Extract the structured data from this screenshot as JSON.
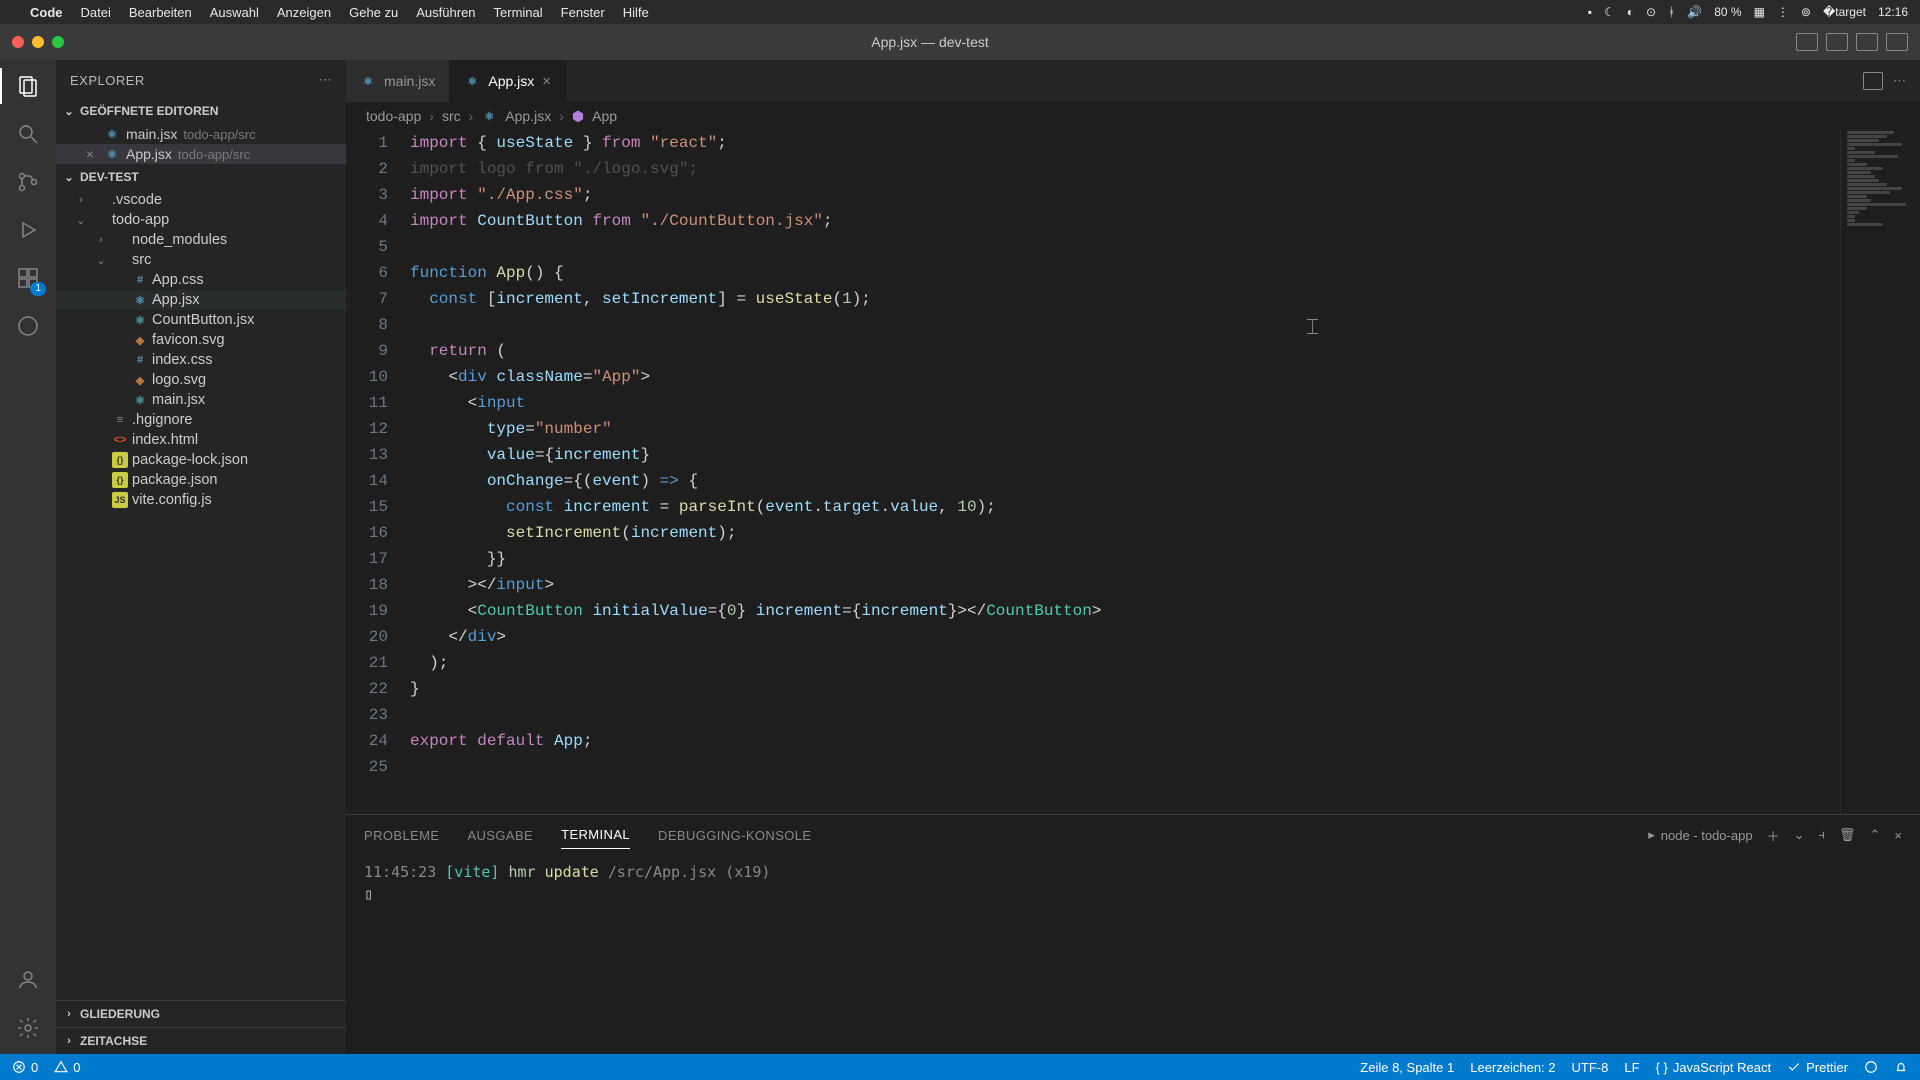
{
  "menubar": {
    "apple": "",
    "app": "Code",
    "items": [
      "Datei",
      "Bearbeiten",
      "Auswahl",
      "Anzeigen",
      "Gehe zu",
      "Ausführen",
      "Terminal",
      "Fenster",
      "Hilfe"
    ],
    "battery": "80 %",
    "clock": "12:16"
  },
  "titlebar": {
    "title": "App.jsx — dev-test"
  },
  "explorer": {
    "title": "EXPLORER",
    "openEditorsHeader": "GEÖFFNETE EDITOREN",
    "openEditors": [
      {
        "name": "main.jsx",
        "path": "todo-app/src",
        "active": false
      },
      {
        "name": "App.jsx",
        "path": "todo-app/src",
        "active": true
      }
    ],
    "workspace": "DEV-TEST",
    "tree": [
      {
        "label": ".vscode",
        "indent": 1,
        "chev": "›",
        "icon": "folder"
      },
      {
        "label": "todo-app",
        "indent": 1,
        "chev": "⌄",
        "icon": "folder"
      },
      {
        "label": "node_modules",
        "indent": 2,
        "chev": "›",
        "icon": "folder"
      },
      {
        "label": "src",
        "indent": 2,
        "chev": "⌄",
        "icon": "folder"
      },
      {
        "label": "App.css",
        "indent": 3,
        "icon": "css"
      },
      {
        "label": "App.jsx",
        "indent": 3,
        "icon": "react",
        "selected": true
      },
      {
        "label": "CountButton.jsx",
        "indent": 3,
        "icon": "react"
      },
      {
        "label": "favicon.svg",
        "indent": 3,
        "icon": "svg"
      },
      {
        "label": "index.css",
        "indent": 3,
        "icon": "css"
      },
      {
        "label": "logo.svg",
        "indent": 3,
        "icon": "svg"
      },
      {
        "label": "main.jsx",
        "indent": 3,
        "icon": "react"
      },
      {
        "label": ".hgignore",
        "indent": 2,
        "icon": "generic"
      },
      {
        "label": "index.html",
        "indent": 2,
        "icon": "html"
      },
      {
        "label": "package-lock.json",
        "indent": 2,
        "icon": "json"
      },
      {
        "label": "package.json",
        "indent": 2,
        "icon": "json"
      },
      {
        "label": "vite.config.js",
        "indent": 2,
        "icon": "js"
      }
    ],
    "outline": "GLIEDERUNG",
    "timeline": "ZEITACHSE"
  },
  "tabs": [
    {
      "name": "main.jsx",
      "active": false
    },
    {
      "name": "App.jsx",
      "active": true
    }
  ],
  "breadcrumb": [
    "todo-app",
    "src",
    "App.jsx",
    "App"
  ],
  "code": {
    "lineCount": 25,
    "lines": [
      [
        [
          "kw",
          "import"
        ],
        [
          "op",
          " { "
        ],
        [
          "var",
          "useState"
        ],
        [
          "op",
          " } "
        ],
        [
          "kw",
          "from"
        ],
        [
          "op",
          " "
        ],
        [
          "str",
          "\"react\""
        ],
        [
          "op",
          ";"
        ]
      ],
      [
        [
          "dim",
          "import logo from \"./logo.svg\";"
        ]
      ],
      [
        [
          "kw",
          "import"
        ],
        [
          "op",
          " "
        ],
        [
          "str",
          "\"./App.css\""
        ],
        [
          "op",
          ";"
        ]
      ],
      [
        [
          "kw",
          "import"
        ],
        [
          "op",
          " "
        ],
        [
          "var",
          "CountButton"
        ],
        [
          "op",
          " "
        ],
        [
          "kw",
          "from"
        ],
        [
          "op",
          " "
        ],
        [
          "str",
          "\"./CountButton.jsx\""
        ],
        [
          "op",
          ";"
        ]
      ],
      [
        [
          "op",
          ""
        ]
      ],
      [
        [
          "kw2",
          "function"
        ],
        [
          "op",
          " "
        ],
        [
          "fn",
          "App"
        ],
        [
          "op",
          "() "
        ],
        [
          "pun",
          "{"
        ]
      ],
      [
        [
          "op",
          "  "
        ],
        [
          "kw2",
          "const"
        ],
        [
          "op",
          " ["
        ],
        [
          "var",
          "increment"
        ],
        [
          "op",
          ", "
        ],
        [
          "var",
          "setIncrement"
        ],
        [
          "op",
          "] = "
        ],
        [
          "fn",
          "useState"
        ],
        [
          "op",
          "("
        ],
        [
          "num",
          "1"
        ],
        [
          "op",
          ");"
        ]
      ],
      [
        [
          "op",
          ""
        ]
      ],
      [
        [
          "op",
          "  "
        ],
        [
          "kw",
          "return"
        ],
        [
          "op",
          " ("
        ]
      ],
      [
        [
          "op",
          "    <"
        ],
        [
          "tag",
          "div"
        ],
        [
          "op",
          " "
        ],
        [
          "attr",
          "className"
        ],
        [
          "op",
          "="
        ],
        [
          "str",
          "\"App\""
        ],
        [
          "op",
          ">"
        ]
      ],
      [
        [
          "op",
          "      <"
        ],
        [
          "tag",
          "input"
        ]
      ],
      [
        [
          "op",
          "        "
        ],
        [
          "attr",
          "type"
        ],
        [
          "op",
          "="
        ],
        [
          "str",
          "\"number\""
        ]
      ],
      [
        [
          "op",
          "        "
        ],
        [
          "attr",
          "value"
        ],
        [
          "op",
          "="
        ],
        [
          "pun",
          "{"
        ],
        [
          "var",
          "increment"
        ],
        [
          "pun",
          "}"
        ]
      ],
      [
        [
          "op",
          "        "
        ],
        [
          "attr",
          "onChange"
        ],
        [
          "op",
          "="
        ],
        [
          "pun",
          "{"
        ],
        [
          "op",
          "("
        ],
        [
          "var",
          "event"
        ],
        [
          "op",
          ") "
        ],
        [
          "kw2",
          "=>"
        ],
        [
          "op",
          " "
        ],
        [
          "pun",
          "{"
        ]
      ],
      [
        [
          "op",
          "          "
        ],
        [
          "kw2",
          "const"
        ],
        [
          "op",
          " "
        ],
        [
          "var",
          "increment"
        ],
        [
          "op",
          " = "
        ],
        [
          "fn",
          "parseInt"
        ],
        [
          "op",
          "("
        ],
        [
          "var",
          "event"
        ],
        [
          "op",
          "."
        ],
        [
          "var",
          "target"
        ],
        [
          "op",
          "."
        ],
        [
          "var",
          "value"
        ],
        [
          "op",
          ", "
        ],
        [
          "num",
          "10"
        ],
        [
          "op",
          ");"
        ]
      ],
      [
        [
          "op",
          "          "
        ],
        [
          "fn",
          "setIncrement"
        ],
        [
          "op",
          "("
        ],
        [
          "var",
          "increment"
        ],
        [
          "op",
          ");"
        ]
      ],
      [
        [
          "op",
          "        "
        ],
        [
          "pun",
          "}}"
        ]
      ],
      [
        [
          "op",
          "      ></"
        ],
        [
          "tag",
          "input"
        ],
        [
          "op",
          ">"
        ]
      ],
      [
        [
          "op",
          "      <"
        ],
        [
          "tagc",
          "CountButton"
        ],
        [
          "op",
          " "
        ],
        [
          "attr",
          "initialValue"
        ],
        [
          "op",
          "="
        ],
        [
          "pun",
          "{"
        ],
        [
          "num",
          "0"
        ],
        [
          "pun",
          "}"
        ],
        [
          "op",
          " "
        ],
        [
          "attr",
          "increment"
        ],
        [
          "op",
          "="
        ],
        [
          "pun",
          "{"
        ],
        [
          "var",
          "increment"
        ],
        [
          "pun",
          "}"
        ],
        [
          "op",
          "></"
        ],
        [
          "tagc",
          "CountButton"
        ],
        [
          "op",
          ">"
        ]
      ],
      [
        [
          "op",
          "    </"
        ],
        [
          "tag",
          "div"
        ],
        [
          "op",
          ">"
        ]
      ],
      [
        [
          "op",
          "  );"
        ]
      ],
      [
        [
          "pun",
          "}"
        ]
      ],
      [
        [
          "op",
          ""
        ]
      ],
      [
        [
          "kw",
          "export"
        ],
        [
          "op",
          " "
        ],
        [
          "kw",
          "default"
        ],
        [
          "op",
          " "
        ],
        [
          "var",
          "App"
        ],
        [
          "op",
          ";"
        ]
      ],
      [
        [
          "op",
          ""
        ]
      ]
    ]
  },
  "panel": {
    "tabs": [
      "PROBLEME",
      "AUSGABE",
      "TERMINAL",
      "DEBUGGING-KONSOLE"
    ],
    "activeTab": 2,
    "shell": "node - todo-app",
    "terminal": {
      "time": "11:45:23",
      "tag": "[vite]",
      "action": "hmr",
      "op": "update",
      "path": "/src/App.jsx",
      "count": "(x19)"
    }
  },
  "statusbar": {
    "errors": "0",
    "warnings": "0",
    "position": "Zeile 8, Spalte 1",
    "spaces": "Leerzeichen: 2",
    "encoding": "UTF-8",
    "eol": "LF",
    "language": "JavaScript React",
    "prettier": "Prettier"
  },
  "activity": {
    "badge": "1"
  }
}
